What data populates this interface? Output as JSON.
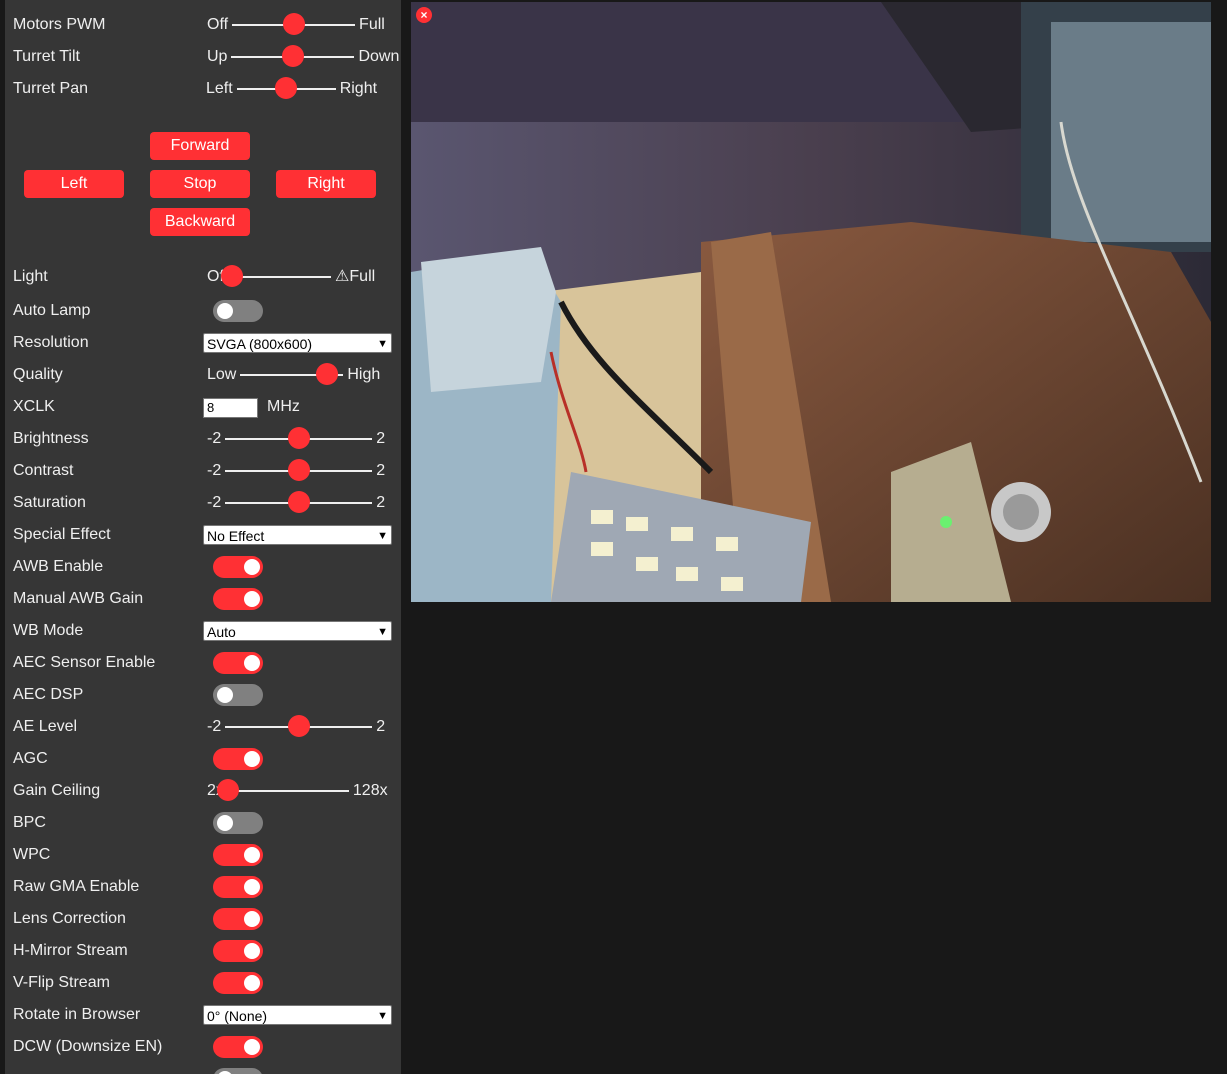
{
  "controls": {
    "motors_pwm": {
      "label": "Motors PWM",
      "min": "Off",
      "max": "Full",
      "value": 0.5
    },
    "turret_tilt": {
      "label": "Turret Tilt",
      "min": "Up",
      "max": "Down",
      "value": 0.5
    },
    "turret_pan": {
      "label": "Turret Pan",
      "min": "Left",
      "max": "Right",
      "value": 0.5
    }
  },
  "drive": {
    "forward": "Forward",
    "left": "Left",
    "stop": "Stop",
    "right": "Right",
    "backward": "Backward"
  },
  "settings": {
    "light": {
      "label": "Light",
      "min": "Off",
      "max": "⚠Full",
      "value": 0
    },
    "auto_lamp": {
      "label": "Auto Lamp",
      "on": false
    },
    "resolution": {
      "label": "Resolution",
      "value": "SVGA (800x600)"
    },
    "quality": {
      "label": "Quality",
      "min": "Low",
      "max": "High",
      "value": 0.84
    },
    "xclk": {
      "label": "XCLK",
      "value": "8",
      "unit": "MHz"
    },
    "brightness": {
      "label": "Brightness",
      "min": "-2",
      "max": "2",
      "value": 0
    },
    "contrast": {
      "label": "Contrast",
      "min": "-2",
      "max": "2",
      "value": 0
    },
    "saturation": {
      "label": "Saturation",
      "min": "-2",
      "max": "2",
      "value": 0
    },
    "special_effect": {
      "label": "Special Effect",
      "value": "No Effect"
    },
    "awb_enable": {
      "label": "AWB Enable",
      "on": true
    },
    "manual_awb_gain": {
      "label": "Manual AWB Gain",
      "on": true
    },
    "wb_mode": {
      "label": "WB Mode",
      "value": "Auto"
    },
    "aec_sensor": {
      "label": "AEC Sensor Enable",
      "on": true
    },
    "aec_dsp": {
      "label": "AEC DSP",
      "on": false
    },
    "ae_level": {
      "label": "AE Level",
      "min": "-2",
      "max": "2",
      "value": 0
    },
    "agc": {
      "label": "AGC",
      "on": true
    },
    "gain_ceiling": {
      "label": "Gain Ceiling",
      "min": "2x",
      "max": "128x",
      "value": 0
    },
    "bpc": {
      "label": "BPC",
      "on": false
    },
    "wpc": {
      "label": "WPC",
      "on": true
    },
    "raw_gma": {
      "label": "Raw GMA Enable",
      "on": true
    },
    "lens_correction": {
      "label": "Lens Correction",
      "on": true
    },
    "hmirror": {
      "label": "H-Mirror Stream",
      "on": true
    },
    "vflip": {
      "label": "V-Flip Stream",
      "on": true
    },
    "rotate": {
      "label": "Rotate in Browser",
      "value": "0° (None)"
    },
    "dcw": {
      "label": "DCW (Downsize EN)",
      "on": true
    }
  },
  "stream": {
    "close_icon": "close-icon",
    "close_glyph": "×"
  },
  "colors": {
    "accent": "#ff3034",
    "panel": "#363636",
    "background": "#181818"
  }
}
